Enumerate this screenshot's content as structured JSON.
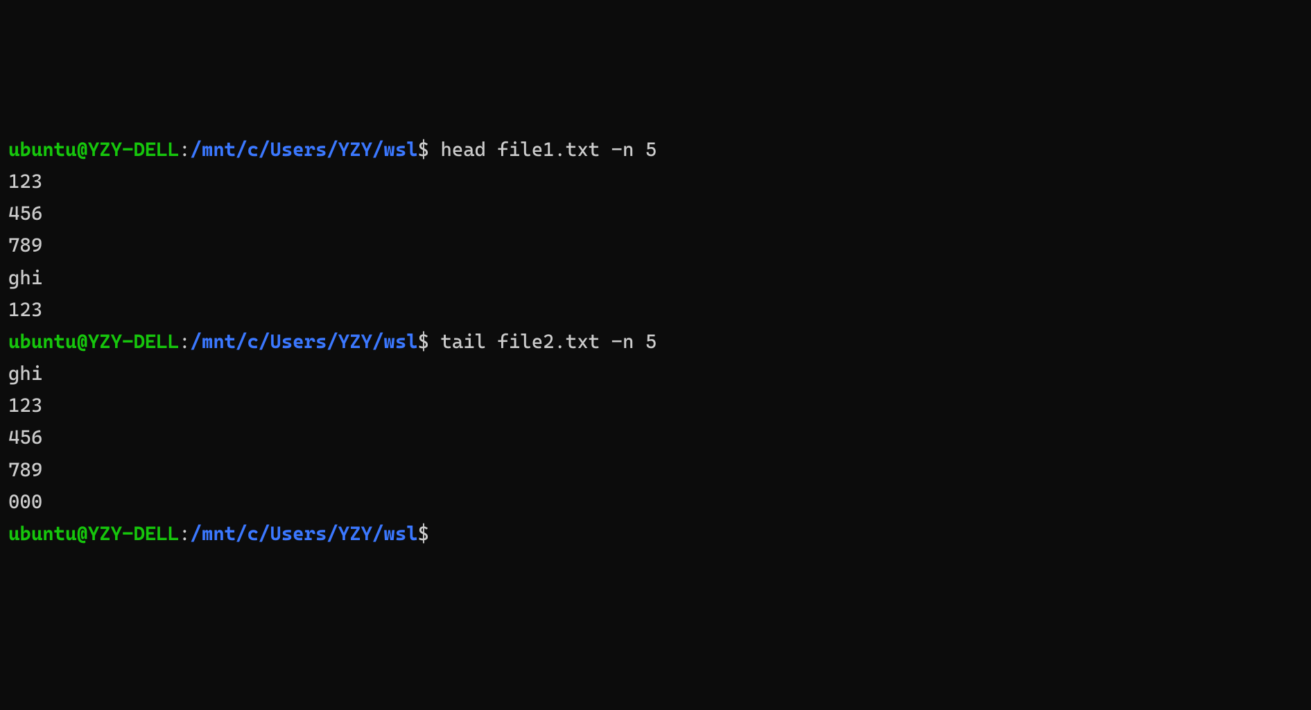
{
  "prompt": {
    "user": "ubuntu@YZY-DELL",
    "separator": ":",
    "path": "/mnt/c/Users/YZY/wsl",
    "dollar": "$"
  },
  "blocks": [
    {
      "command": " head file1.txt -n 5",
      "output": [
        "123",
        "456",
        "789",
        "ghi",
        "123"
      ]
    },
    {
      "command": " tail file2.txt -n 5",
      "output": [
        "ghi",
        "123",
        "456",
        "789",
        "000"
      ]
    }
  ],
  "final_command": " "
}
